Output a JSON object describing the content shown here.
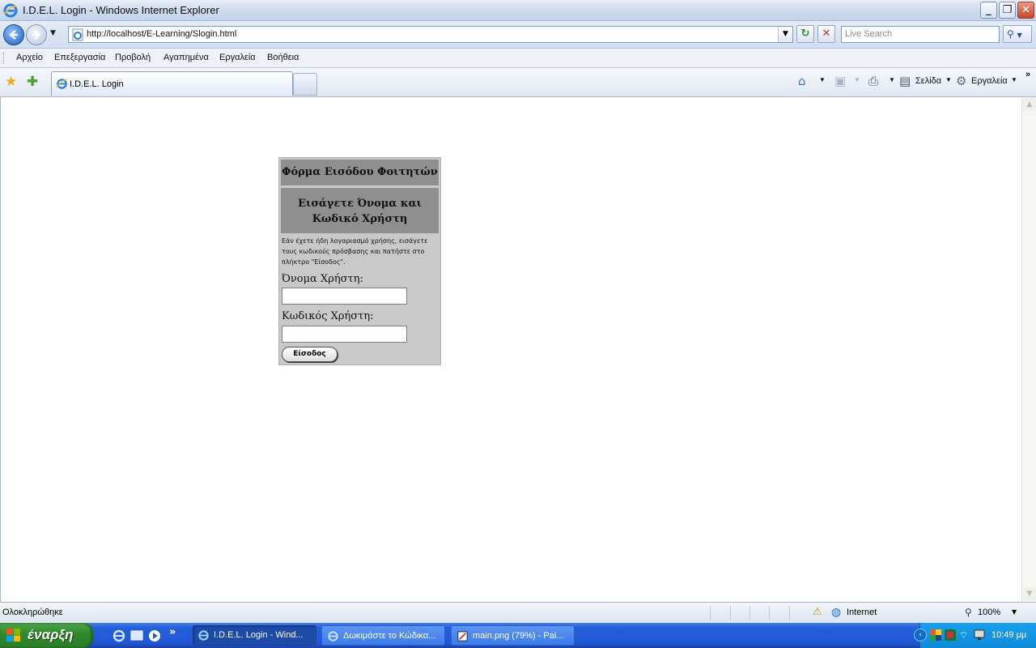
{
  "window": {
    "title": "I.D.E.L. Login - Windows Internet Explorer"
  },
  "address_bar": {
    "url": "http://localhost/E-Learning/Slogin.html",
    "search_placeholder": "Live Search"
  },
  "menu": {
    "items": [
      "Αρχείο",
      "Επεξεργασία",
      "Προβολή",
      "Αγαπημένα",
      "Εργαλεία",
      "Βοήθεια"
    ]
  },
  "tabs": [
    {
      "label": "I.D.E.L. Login"
    }
  ],
  "command_bar": {
    "page_label": "Σελίδα",
    "tools_label": "Εργαλεία"
  },
  "login_form": {
    "heading": "Φόρμα Εισόδου Φοιτητών",
    "subheading": "Εισάγετε Όνομα και Κωδικό Χρήστη",
    "info": "Εάν έχετε ήδη λογαριασμό χρήσης, εισάγετε τους κωδικούς πρόσβασης και πατήστε στο πλήκτρο \"Είσοδος\".",
    "username_label": "Όνομα Χρήστη:",
    "username_value": "",
    "password_label": "Κωδικός Χρήστη:",
    "password_value": "",
    "submit_label": "Είσοδος"
  },
  "status_bar": {
    "status": "Ολοκληρώθηκε",
    "zone": "Internet",
    "zoom": "100%"
  },
  "taskbar": {
    "start_label": "έναρξη",
    "tasks": [
      {
        "label": "I.D.E.L. Login - Wind...",
        "active": true
      },
      {
        "label": "Δωκιμάστε το Κώδικα...",
        "active": false
      },
      {
        "label": "main.png (79%) - Pai...",
        "active": false
      }
    ],
    "clock": "10:49 μμ"
  },
  "colors": {
    "form_background": "#c9c9c9",
    "form_header": "#8f8f8f",
    "taskbar_blue": "#245edb",
    "start_green": "#2f8b2c"
  }
}
